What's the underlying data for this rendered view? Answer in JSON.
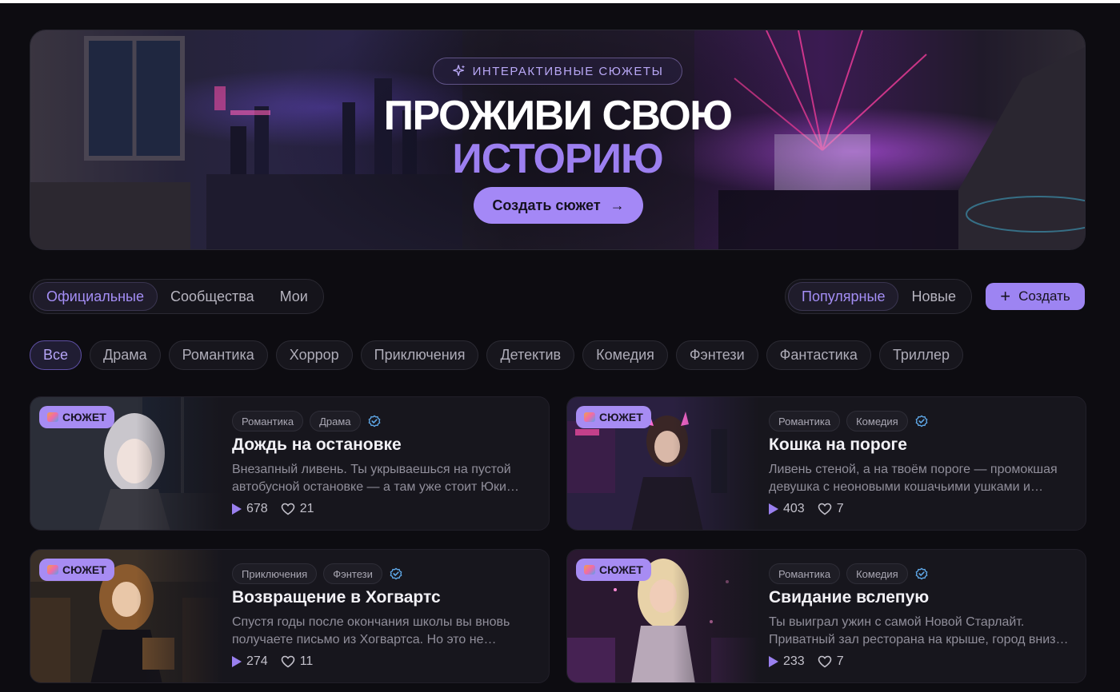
{
  "hero": {
    "badge": "ИНТЕРАКТИВНЫЕ СЮЖЕТЫ",
    "title_line1": "ПРОЖИВИ СВОЮ",
    "title_line2": "ИСТОРИЮ",
    "cta": "Создать сюжет",
    "accent": "#a488f6"
  },
  "source_tabs": [
    {
      "label": "Официальные",
      "active": true
    },
    {
      "label": "Сообщества",
      "active": false
    },
    {
      "label": "Мои",
      "active": false
    }
  ],
  "sort_tabs": [
    {
      "label": "Популярные",
      "active": true
    },
    {
      "label": "Новые",
      "active": false
    }
  ],
  "create_button": "Создать",
  "genres": [
    "Все",
    "Драма",
    "Романтика",
    "Хоррор",
    "Приключения",
    "Детектив",
    "Комедия",
    "Фэнтези",
    "Фантастика",
    "Триллер"
  ],
  "active_genre": "Все",
  "plot_badge": "СЮЖЕТ",
  "cards": [
    {
      "tags": [
        "Романтика",
        "Драма"
      ],
      "title": "Дождь на остановке",
      "desc": "Внезапный ливень. Ты укрываешься на пустой автобусной остановке — а там уже стоит Юки…",
      "plays": "678",
      "likes": "21",
      "verified": true
    },
    {
      "tags": [
        "Романтика",
        "Комедия"
      ],
      "title": "Кошка на пороге",
      "desc": "Ливень стеной, а на твоём пороге — промокшая девушка с неоновыми кошачьими ушками и…",
      "plays": "403",
      "likes": "7",
      "verified": true
    },
    {
      "tags": [
        "Приключения",
        "Фэнтези"
      ],
      "title": "Возвращение в Хогвартс",
      "desc": "Спустя годы после окончания школы вы вновь получаете письмо из Хогвартса. Но это не…",
      "plays": "274",
      "likes": "11",
      "verified": true
    },
    {
      "tags": [
        "Романтика",
        "Комедия"
      ],
      "title": "Свидание вслепую",
      "desc": "Ты выиграл ужин с самой Новой Старлайт. Приватный зал ресторана на крыше, город вниз…",
      "plays": "233",
      "likes": "7",
      "verified": true
    }
  ]
}
